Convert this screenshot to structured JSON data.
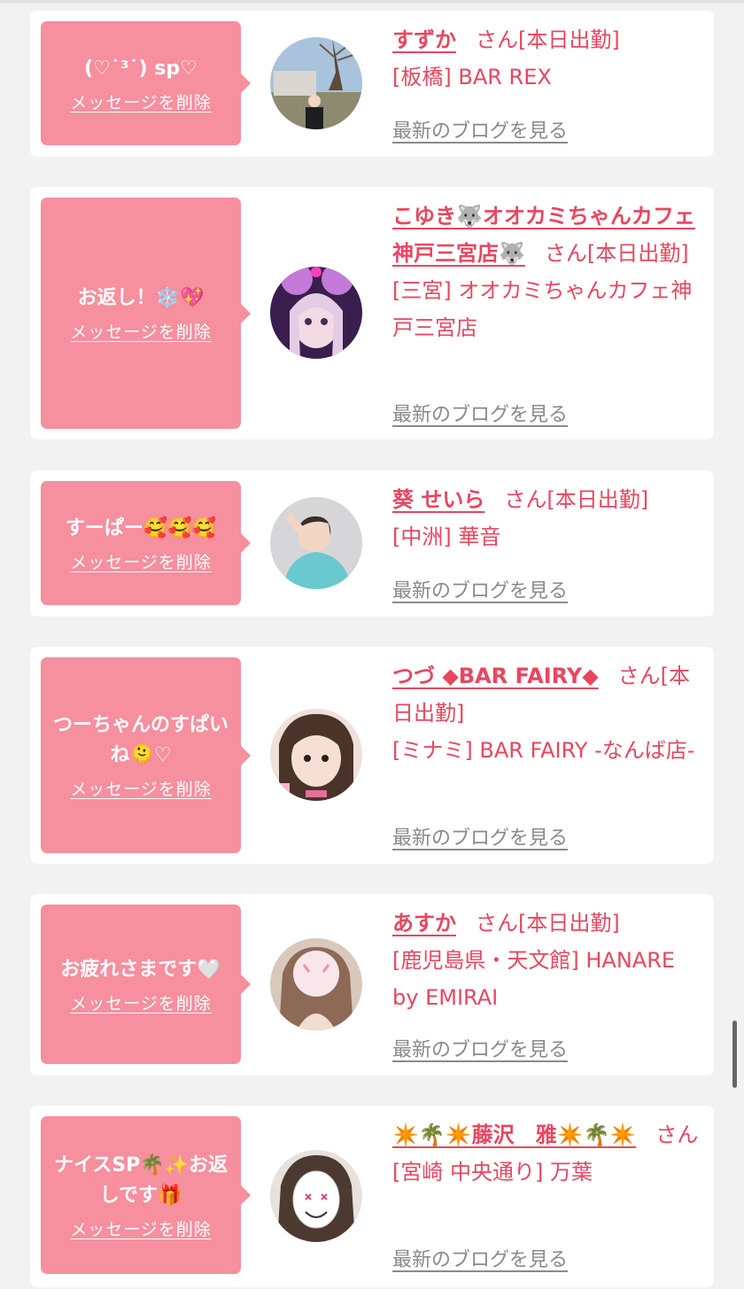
{
  "delete_label": "メッセージを削除",
  "blog_label": "最新のブログを見る",
  "colors": {
    "page_bg": "#f2f2f2",
    "bubble": "#f68f9e",
    "accent": "#e8475f",
    "blog_link": "#8a8a8a"
  },
  "cards": [
    {
      "message": "(♡˙³˙) sp♡",
      "name": "すずか",
      "suffix": "さん[本日出勤]",
      "shop": "[板橋] BAR REX"
    },
    {
      "message": "お返し！❄️💖",
      "name": "こゆき🐺オオカミちゃんカフェ神戸三宮店🐺",
      "suffix": "さん[本日出勤]",
      "shop": "[三宮] オオカミちゃんカフェ神戸三宮店"
    },
    {
      "message": "すーぱー🥰🥰🥰",
      "name": "葵 せいら",
      "suffix": "さん[本日出勤]",
      "shop": "[中洲] 華音"
    },
    {
      "message": "つーちゃんのすぱいね🫠♡",
      "name": "つづ ◆BAR FAIRY◆",
      "suffix": "さん[本日出勤]",
      "shop": "[ミナミ] BAR FAIRY -なんば店-"
    },
    {
      "message": "お疲れさまです🤍",
      "name": "あすか",
      "suffix": "さん[本日出勤]",
      "shop": "[鹿児島県・天文館] HANARE by EMIRAI"
    },
    {
      "message": "ナイスSP🌴✨お返しです🎁",
      "name": "✴️🌴✴️藤沢　雅✴️🌴✴️",
      "suffix": "さん",
      "shop": "[宮崎 中央通り] 万葉"
    }
  ]
}
